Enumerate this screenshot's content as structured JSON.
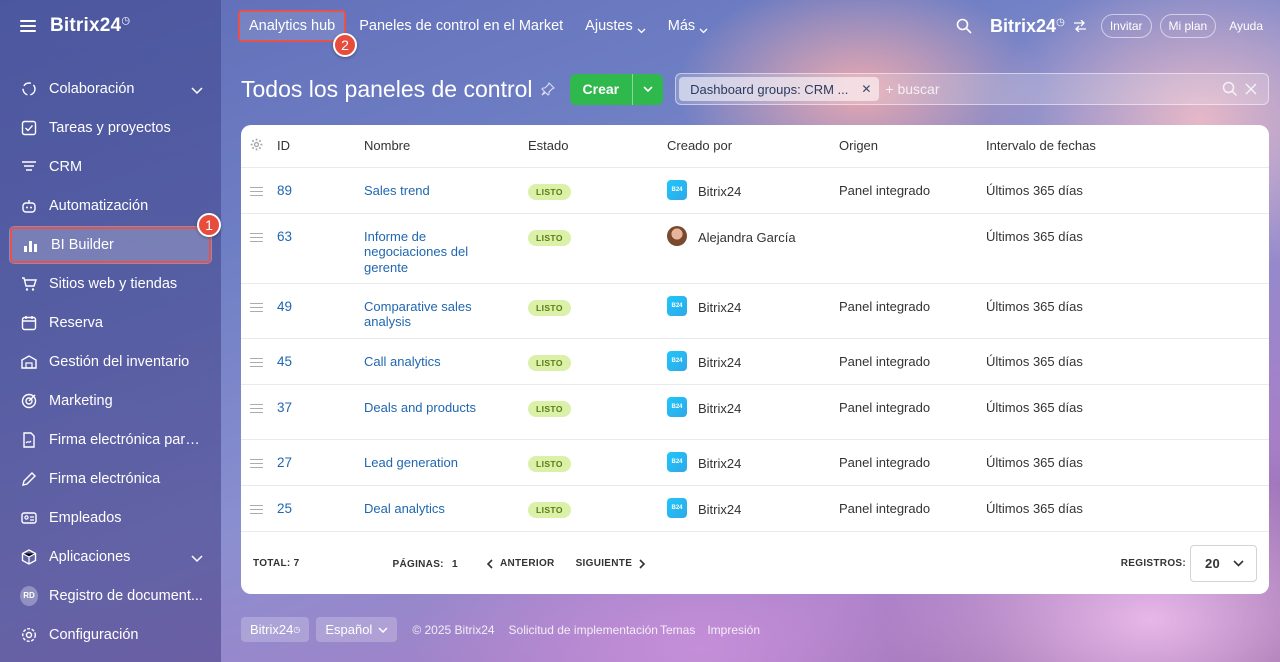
{
  "sidebar": {
    "brand": "Bitrix24",
    "items": [
      {
        "label": "Colaboración",
        "icon": "collaboration-icon",
        "chevron": true
      },
      {
        "label": "Tareas y proyectos",
        "icon": "tasks-icon"
      },
      {
        "label": "CRM",
        "icon": "crm-icon"
      },
      {
        "label": "Automatización",
        "icon": "automation-icon"
      },
      {
        "label": "BI Builder",
        "icon": "bi-chart-icon",
        "active": true
      },
      {
        "label": "Sitios web y tiendas",
        "icon": "cart-icon"
      },
      {
        "label": "Reserva",
        "icon": "calendar-icon"
      },
      {
        "label": "Gestión del inventario",
        "icon": "inventory-icon"
      },
      {
        "label": "Marketing",
        "icon": "marketing-icon"
      },
      {
        "label": "Firma electrónica para...",
        "icon": "document-sign-icon"
      },
      {
        "label": "Firma electrónica",
        "icon": "pen-icon"
      },
      {
        "label": "Empleados",
        "icon": "employees-icon"
      },
      {
        "label": "Aplicaciones",
        "icon": "apps-icon",
        "chevron": true
      },
      {
        "label": "Registro de document...",
        "avatar": "RD"
      },
      {
        "label": "Configuración",
        "icon": "settings-icon"
      }
    ],
    "badge_1": "1"
  },
  "topbar": {
    "tabs": [
      {
        "label": "Analytics hub",
        "highlighted": true
      },
      {
        "label": "Paneles de control en el Market"
      },
      {
        "label": "Ajustes",
        "dropdown": true
      },
      {
        "label": "Más",
        "dropdown": true
      }
    ],
    "badge_2": "2",
    "brand": "Bitrix24",
    "invite": "Invitar",
    "plan": "Mi plan",
    "help": "Ayuda"
  },
  "page": {
    "title": "Todos los paneles de control",
    "create_label": "Crear",
    "filter_tag": "Dashboard groups: CRM ...",
    "search_placeholder": "+ buscar"
  },
  "grid": {
    "columns": [
      "ID",
      "Nombre",
      "Estado",
      "Creado por",
      "Origen",
      "Intervalo de fechas"
    ],
    "rows": [
      {
        "id": "89",
        "name": "Sales trend",
        "status": "LISTO",
        "creator": "Bitrix24",
        "creator_type": "b24",
        "origin": "Panel integrado",
        "range": "Últimos 365 días"
      },
      {
        "id": "63",
        "name": "Informe de negociaciones del gerente",
        "status": "LISTO",
        "creator": "Alejandra García",
        "creator_type": "person",
        "origin": "",
        "range": "Últimos 365 días"
      },
      {
        "id": "49",
        "name": "Comparative sales analysis",
        "status": "LISTO",
        "creator": "Bitrix24",
        "creator_type": "b24",
        "origin": "Panel integrado",
        "range": "Últimos 365 días"
      },
      {
        "id": "45",
        "name": "Call analytics",
        "status": "LISTO",
        "creator": "Bitrix24",
        "creator_type": "b24",
        "origin": "Panel integrado",
        "range": "Últimos 365 días"
      },
      {
        "id": "37",
        "name": "Deals and products",
        "status": "LISTO",
        "creator": "Bitrix24",
        "creator_type": "b24",
        "origin": "Panel integrado",
        "range": "Últimos 365 días"
      },
      {
        "id": "27",
        "name": "Lead generation",
        "status": "LISTO",
        "creator": "Bitrix24",
        "creator_type": "b24",
        "origin": "Panel integrado",
        "range": "Últimos 365 días"
      },
      {
        "id": "25",
        "name": "Deal analytics",
        "status": "LISTO",
        "creator": "Bitrix24",
        "creator_type": "b24",
        "origin": "Panel integrado",
        "range": "Últimos 365 días"
      }
    ],
    "b24_icon_text": "B24",
    "pager": {
      "total_label": "TOTAL:",
      "total": "7",
      "pages_label": "PÁGINAS:",
      "page": "1",
      "prev": "ANTERIOR",
      "next": "SIGUIENTE",
      "records_label": "REGISTROS:",
      "records": "20"
    }
  },
  "footer": {
    "brand": "Bitrix24",
    "language": "Español",
    "copyright": "© 2025 Bitrix24",
    "implementation": "Solicitud de implementación",
    "themes": "Temas",
    "print": "Impresión"
  },
  "colors": {
    "accent_green": "#2fb84b",
    "link_blue": "#2067b0",
    "status_bg": "#dbf0a8",
    "highlight_red": "#e8524a"
  }
}
